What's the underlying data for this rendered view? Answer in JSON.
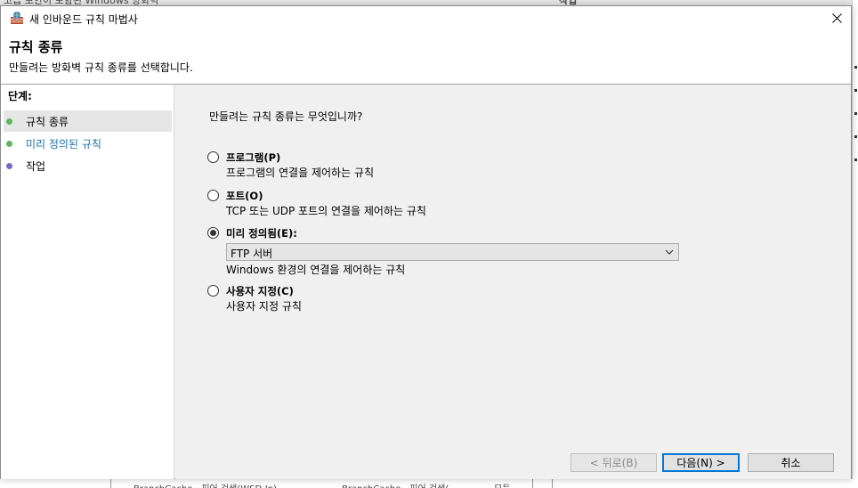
{
  "window": {
    "title": "새 인바운드 규칙 마법사"
  },
  "header": {
    "title": "규칙 종류",
    "description": "만들려는 방화벽 규칙 종류를 선택합니다."
  },
  "steps": {
    "label": "단계:",
    "items": [
      {
        "label": "규칙 종류",
        "dot_color": "#5cb85c",
        "state": "current"
      },
      {
        "label": "미리 정의된 규칙",
        "dot_color": "#5cb85c",
        "state": "link"
      },
      {
        "label": "작업",
        "dot_color": "#7b68c8",
        "state": "pending"
      }
    ]
  },
  "content": {
    "question": "만들려는 규칙 종류는 무엇입니까?",
    "options": [
      {
        "label": "프로그램(P)",
        "description": "프로그램의 연결을 제어하는 규칙",
        "checked": false
      },
      {
        "label": "포트(O)",
        "description": "TCP 또는 UDP 포트의 연결을 제어하는 규칙",
        "checked": false
      },
      {
        "label": "미리 정의됨(E):",
        "description": "Windows 환경의 연결을 제어하는 규칙",
        "checked": true
      },
      {
        "label": "사용자 지정(C)",
        "description": "사용자 지정 규칙",
        "checked": false
      }
    ],
    "predefined_select": {
      "value": "FTP 서버"
    }
  },
  "buttons": {
    "back": "< 뒤로(B)",
    "next": "다음(N) >",
    "cancel": "취소"
  },
  "background": {
    "row_cells": [
      "BranchCache - 피어 검색(WSD-In)",
      "BranchCache - 피어 검색(",
      "모든"
    ]
  }
}
